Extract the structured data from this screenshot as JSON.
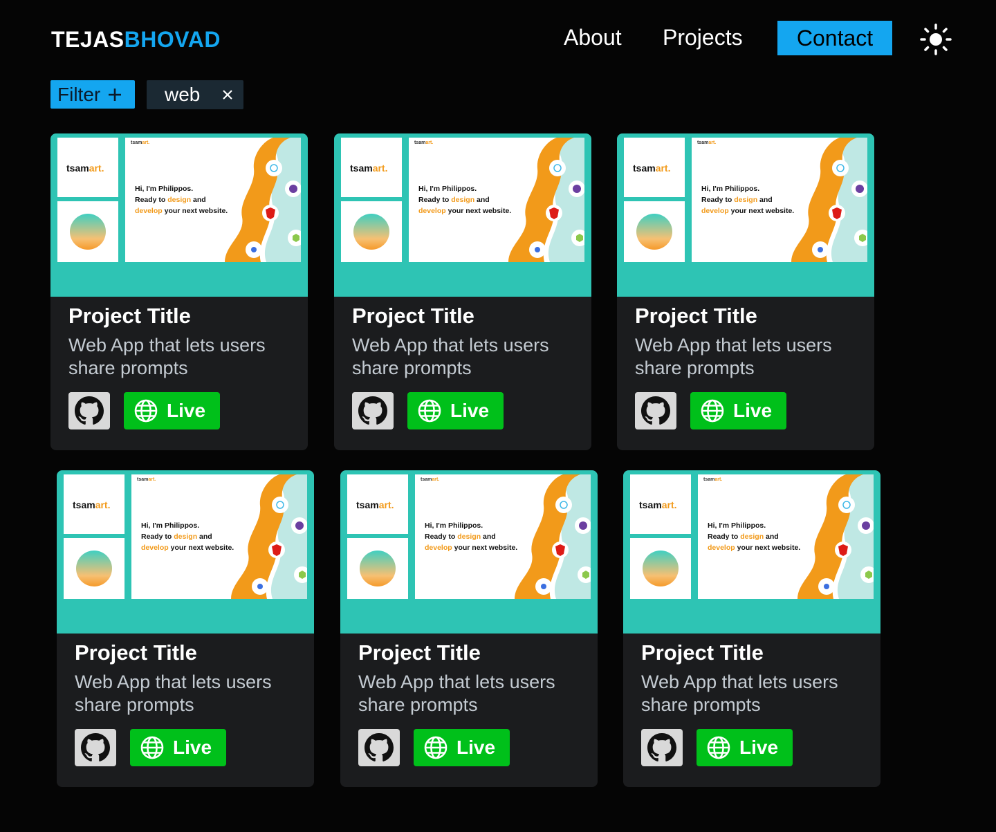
{
  "header": {
    "logo_first": "TEJAS",
    "logo_last": "BHOVAD",
    "nav": {
      "about": "About",
      "projects": "Projects",
      "contact": "Contact"
    },
    "theme_icon": "sun-icon"
  },
  "filter": {
    "button_label": "Filter",
    "button_icon": "plus-icon",
    "active_tag": "web",
    "tag_close_icon": "close-icon"
  },
  "colors": {
    "accent": "#14a6f0",
    "live": "#00c01a",
    "thumb_bg": "#2ec4b4",
    "card_bg": "#1b1c1e",
    "orange": "#f29a1a"
  },
  "projects": [
    {
      "title": "Project Title",
      "description": "Web App that lets users share prompts",
      "live_label": "Live",
      "thumbnail": {
        "logo_main": "tsam",
        "logo_accent": "art.",
        "line1": "Hi, I'm Philippos.",
        "line2a": "Ready to ",
        "line2b": "design",
        "line2c": " and",
        "line3a": "develop",
        "line3b": " your next website."
      }
    },
    {
      "title": "Project Title",
      "description": "Web App that lets users share prompts",
      "live_label": "Live",
      "thumbnail": {
        "logo_main": "tsam",
        "logo_accent": "art.",
        "line1": "Hi, I'm Philippos.",
        "line2a": "Ready to ",
        "line2b": "design",
        "line2c": " and",
        "line3a": "develop",
        "line3b": " your next website."
      }
    },
    {
      "title": "Project Title",
      "description": "Web App that lets users share prompts",
      "live_label": "Live",
      "thumbnail": {
        "logo_main": "tsam",
        "logo_accent": "art.",
        "line1": "Hi, I'm Philippos.",
        "line2a": "Ready to ",
        "line2b": "design",
        "line2c": " and",
        "line3a": "develop",
        "line3b": " your next website."
      }
    },
    {
      "title": "Project Title",
      "description": "Web App that lets users share prompts",
      "live_label": "Live",
      "thumbnail": {
        "logo_main": "tsam",
        "logo_accent": "art.",
        "line1": "Hi, I'm Philippos.",
        "line2a": "Ready to ",
        "line2b": "design",
        "line2c": " and",
        "line3a": "develop",
        "line3b": " your next website."
      }
    },
    {
      "title": "Project Title",
      "description": "Web App that lets users share prompts",
      "live_label": "Live",
      "thumbnail": {
        "logo_main": "tsam",
        "logo_accent": "art.",
        "line1": "Hi, I'm Philippos.",
        "line2a": "Ready to ",
        "line2b": "design",
        "line2c": " and",
        "line3a": "develop",
        "line3b": " your next website."
      }
    },
    {
      "title": "Project Title",
      "description": "Web App that lets users share prompts",
      "live_label": "Live",
      "thumbnail": {
        "logo_main": "tsam",
        "logo_accent": "art.",
        "line1": "Hi, I'm Philippos.",
        "line2a": "Ready to ",
        "line2b": "design",
        "line2c": " and",
        "line3a": "develop",
        "line3b": " your next website."
      }
    }
  ]
}
